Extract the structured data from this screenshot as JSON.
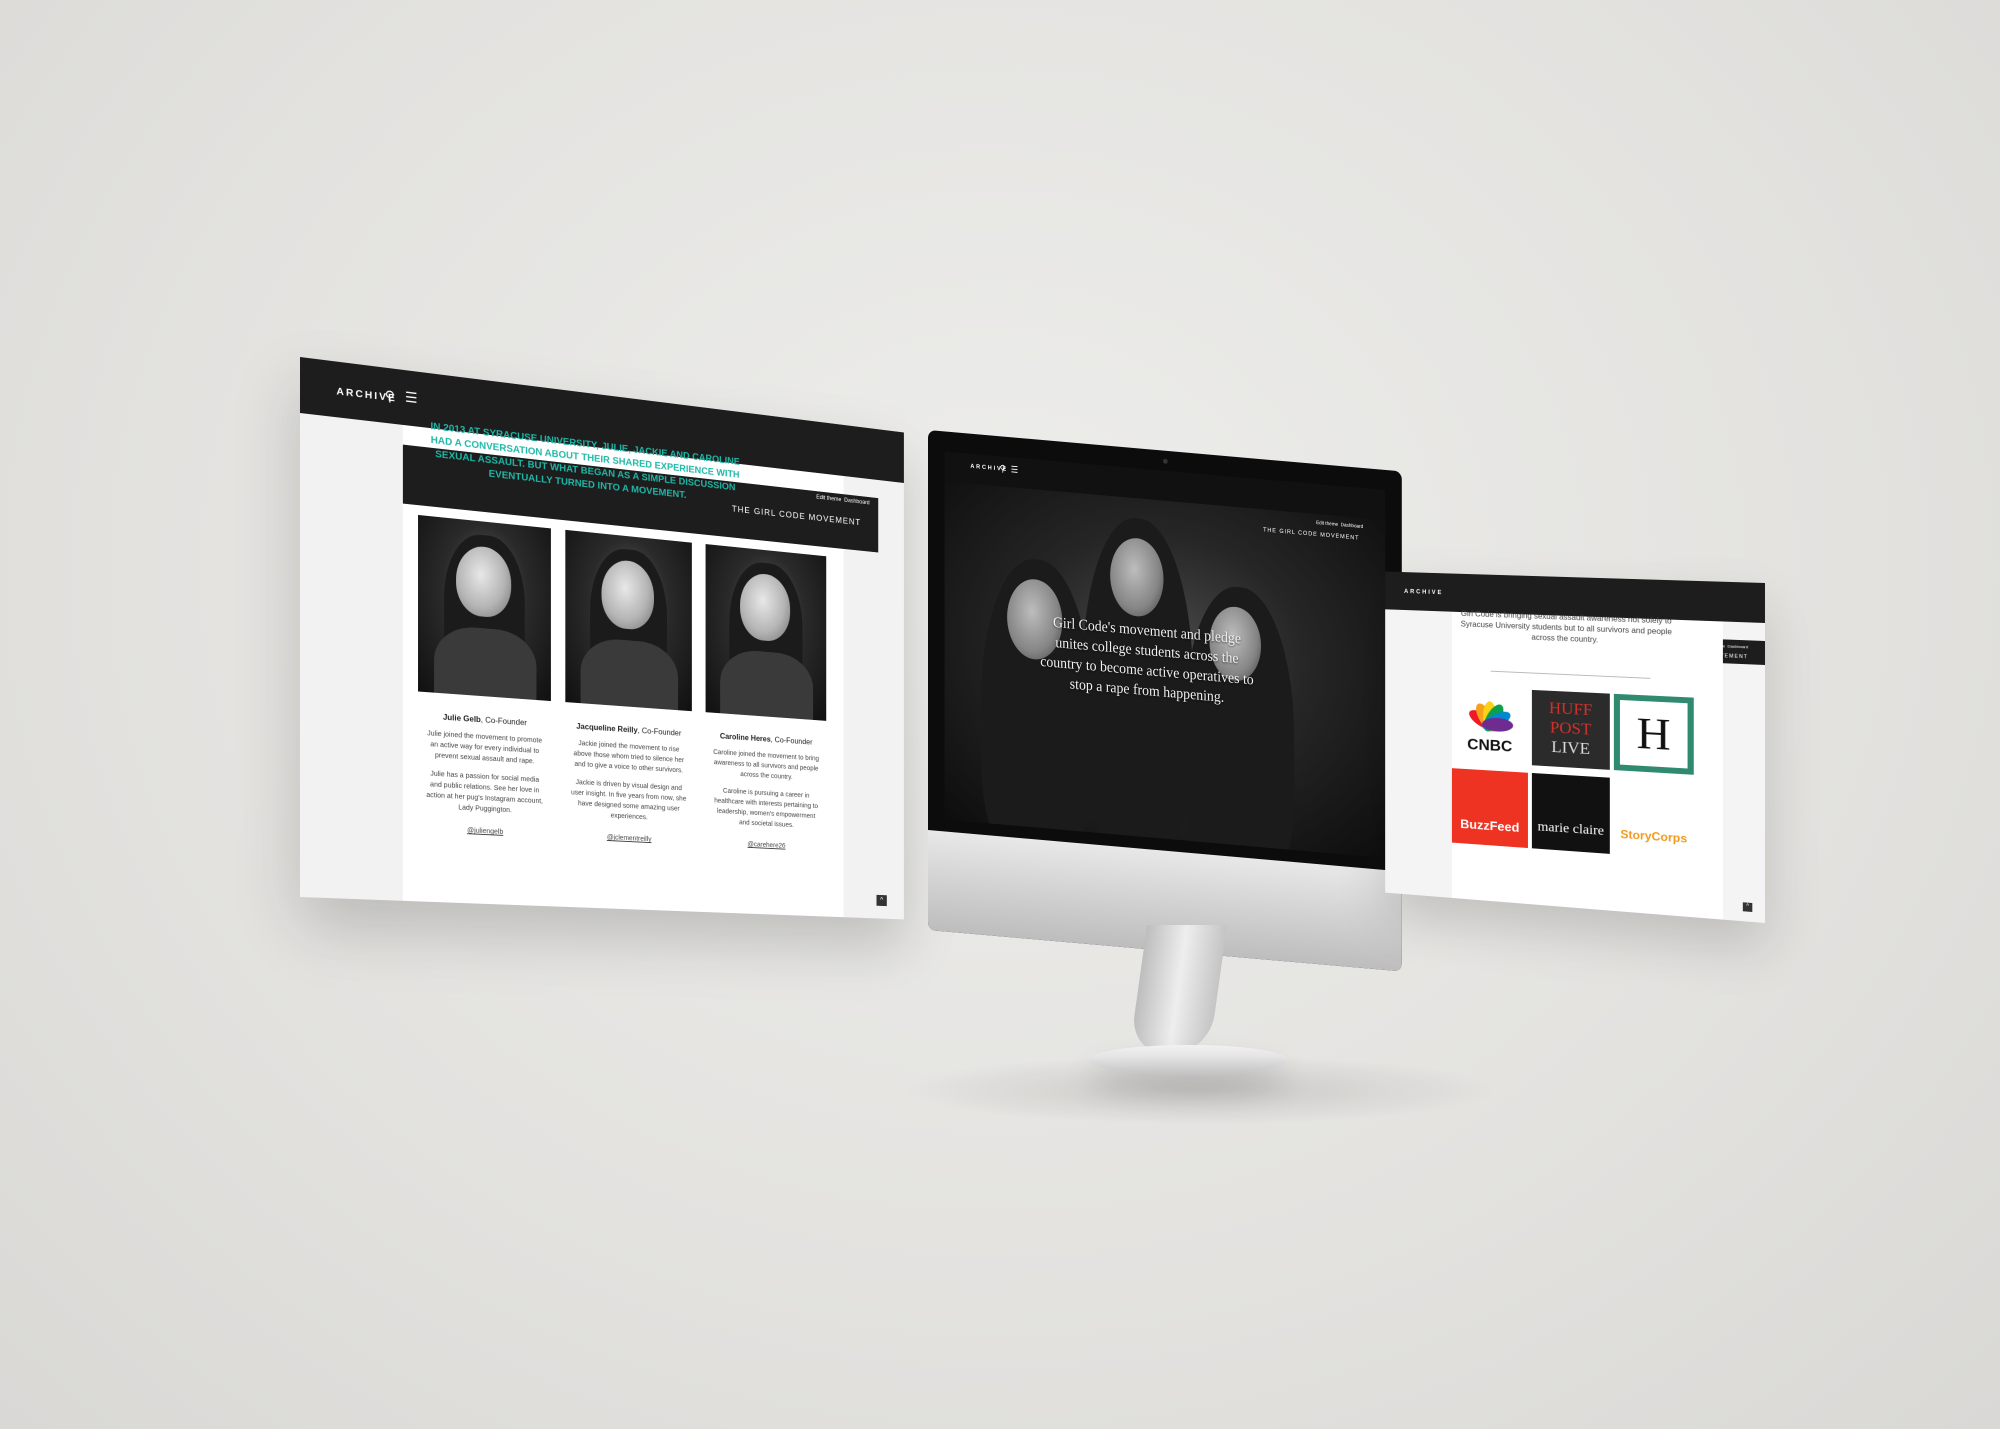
{
  "brand": {
    "logo": "ARCHIVE"
  },
  "header": {
    "edit_theme": "Edit theme",
    "dashboard": "Dashboard",
    "site_title": "THE GIRL CODE MOVEMENT"
  },
  "about": {
    "intro": "IN 2013 AT SYRACUSE UNIVERSITY, JULIE, JACKIE AND CAROLINE HAD A CONVERSATION ABOUT THEIR SHARED EXPERIENCE WITH SEXUAL ASSAULT. BUT WHAT BEGAN AS A SIMPLE DISCUSSION EVENTUALLY TURNED INTO A MOVEMENT.",
    "people": [
      {
        "name": "Julie Gelb",
        "role": ", Co-Founder",
        "bio1": "Julie joined the movement to promote an active way for every individual to prevent sexual assault and rape.",
        "bio2": "Julie has a passion for social media and public relations. See her love in action at her pug's Instagram account, Lady Puggington.",
        "handle": "@juliengelb"
      },
      {
        "name": "Jacqueline Reilly",
        "role": ", Co-Founder",
        "bio1": "Jackie joined the movement to rise above those whom tried to silence her and to give a voice to other survivors.",
        "bio2": "Jackie is driven by visual design and user insight. In five years from now, she have designed some amazing user experiences.",
        "handle": "@jclementreilly"
      },
      {
        "name": "Caroline Heres",
        "role": ", Co-Founder",
        "bio1": "Caroline joined the movement to bring awareness to all survivors and people across the country.",
        "bio2": "Caroline is pursuing a career in healthcare with interests pertaining to leadership, women's empowerment and societal issues.",
        "handle": "@carehere26"
      }
    ]
  },
  "hero": {
    "quote": "Girl Code's movement and pledge unites college students across the country to become active operatives to stop a rape from happening."
  },
  "press": {
    "text": "Girl Code is bringing sexual assault awareness not solely to Syracuse University students but to all survivors and people across the country.",
    "logos": [
      {
        "name": "CNBC",
        "bg": "#ffffff",
        "fg": "#111111"
      },
      {
        "name": "HUFF POST LIVE",
        "line1": "HUFF",
        "line2": "POST",
        "line3": "LIVE",
        "bg": "#2b2b2b",
        "fg": "#d8312a"
      },
      {
        "name": "H",
        "bg": "#2f8a6f",
        "fg": "#111111"
      },
      {
        "name": "BuzzFeed",
        "bg": "#ee3322",
        "fg": "#ffffff"
      },
      {
        "name": "marie claire",
        "bg": "#111111",
        "fg": "#ffffff"
      },
      {
        "name": "StoryCorps",
        "bg": "#ffffff",
        "fg": "#f19a1b"
      }
    ]
  },
  "ui": {
    "back_to_top": "^"
  }
}
